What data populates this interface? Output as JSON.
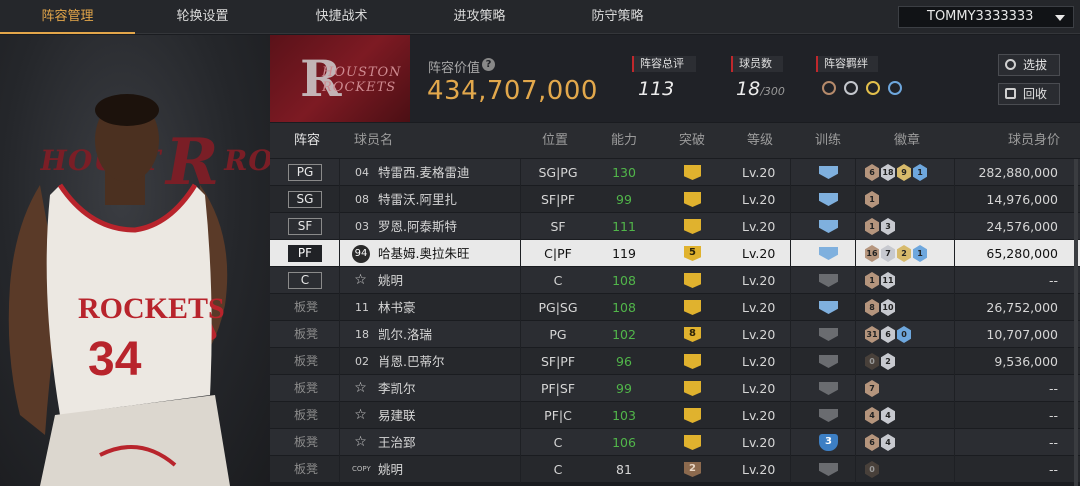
{
  "nav": {
    "tabs": [
      {
        "label": "阵容管理",
        "active": true
      },
      {
        "label": "轮换设置"
      },
      {
        "label": "快捷战术"
      },
      {
        "label": "进攻策略"
      },
      {
        "label": "防守策略"
      }
    ],
    "user": "TOMMY3333333"
  },
  "team": {
    "name": "HOUSTON ROCKETS",
    "value_label": "阵容价值",
    "value": "434,707,000",
    "overall_label": "阵容总评",
    "overall": "113",
    "count_label": "球员数",
    "count": "18",
    "count_max": "/300",
    "chem_label": "阵容羁绊",
    "chem_icons": [
      "bronze-team-icon",
      "silver-team-icon",
      "gold-team-icon",
      "blue-team-icon"
    ],
    "btn_select": "选拔",
    "btn_recycle": "回收"
  },
  "player_panel": {
    "background_logo": "HOUSTON ROCKETS",
    "jersey_team": "ROCKETS",
    "jersey_number": "34"
  },
  "table": {
    "headers": {
      "lineup": "阵容",
      "name": "球员名",
      "position": "位置",
      "ability": "能力",
      "breakthrough": "突破",
      "level": "等级",
      "training": "训练",
      "badges": "徽章",
      "value": "球员身价"
    },
    "rows": [
      {
        "slot": "PG",
        "num": "04",
        "numtype": "plain",
        "name": "特雷西.麦格雷迪",
        "pos": "SG|PG",
        "ability": "130",
        "green": true,
        "bt": "",
        "bt_type": "gold",
        "level": "Lv.20",
        "train": "blue",
        "badges": [
          [
            "bronze",
            "6"
          ],
          [
            "silver",
            "18"
          ],
          [
            "gold",
            "9"
          ],
          [
            "blue",
            "1"
          ]
        ],
        "value": "282,880,000"
      },
      {
        "slot": "SG",
        "num": "08",
        "numtype": "plain",
        "name": "特雷沃.阿里扎",
        "pos": "SF|PF",
        "ability": "99",
        "green": true,
        "bt": "",
        "bt_type": "gold",
        "level": "Lv.20",
        "train": "blue",
        "badges": [
          [
            "bronze",
            "1"
          ]
        ],
        "value": "14,976,000"
      },
      {
        "slot": "SF",
        "num": "03",
        "numtype": "plain",
        "name": "罗恩.阿泰斯特",
        "pos": "SF",
        "ability": "111",
        "green": true,
        "bt": "",
        "bt_type": "gold",
        "level": "Lv.20",
        "train": "blue",
        "badges": [
          [
            "bronze",
            "1"
          ],
          [
            "silver",
            "3"
          ]
        ],
        "value": "24,576,000"
      },
      {
        "slot": "PF",
        "num": "94",
        "numtype": "circle",
        "name": "哈基姆.奥拉朱旺",
        "pos": "C|PF",
        "ability": "119",
        "green": false,
        "bt": "5",
        "bt_type": "gold",
        "level": "Lv.20",
        "train": "blue",
        "badges": [
          [
            "bronze",
            "16"
          ],
          [
            "silver",
            "7"
          ],
          [
            "gold",
            "2"
          ],
          [
            "blue",
            "1"
          ]
        ],
        "value": "65,280,000",
        "selected": true
      },
      {
        "slot": "C",
        "num": "☆",
        "numtype": "star",
        "name": "姚明",
        "pos": "C",
        "ability": "108",
        "green": true,
        "bt": "",
        "bt_type": "gold",
        "level": "Lv.20",
        "train": "grey",
        "badges": [
          [
            "bronze",
            "1"
          ],
          [
            "silver",
            "11"
          ]
        ],
        "value": "--"
      },
      {
        "slot": "板凳",
        "num": "11",
        "numtype": "plain",
        "name": "林书豪",
        "pos": "PG|SG",
        "ability": "108",
        "green": true,
        "bt": "",
        "bt_type": "gold",
        "level": "Lv.20",
        "train": "blue",
        "badges": [
          [
            "bronze",
            "8"
          ],
          [
            "silver",
            "10"
          ]
        ],
        "value": "26,752,000"
      },
      {
        "slot": "板凳",
        "num": "18",
        "numtype": "plain",
        "name": "凯尔.洛瑞",
        "pos": "PG",
        "ability": "102",
        "green": true,
        "bt": "8",
        "bt_type": "gold",
        "level": "Lv.20",
        "train": "grey",
        "badges": [
          [
            "bronze",
            "31"
          ],
          [
            "silver",
            "6"
          ],
          [
            "blue",
            "0"
          ]
        ],
        "value": "10,707,000"
      },
      {
        "slot": "板凳",
        "num": "02",
        "numtype": "plain",
        "name": "肖恩.巴蒂尔",
        "pos": "SF|PF",
        "ability": "96",
        "green": true,
        "bt": "",
        "bt_type": "gold",
        "level": "Lv.20",
        "train": "grey",
        "badges": [
          [
            "dark",
            "0"
          ],
          [
            "silver",
            "2"
          ]
        ],
        "value": "9,536,000"
      },
      {
        "slot": "板凳",
        "num": "☆",
        "numtype": "star",
        "name": "李凯尔",
        "pos": "PF|SF",
        "ability": "99",
        "green": true,
        "bt": "",
        "bt_type": "gold",
        "level": "Lv.20",
        "train": "grey",
        "badges": [
          [
            "bronze",
            "7"
          ]
        ],
        "value": "--"
      },
      {
        "slot": "板凳",
        "num": "☆",
        "numtype": "star",
        "name": "易建联",
        "pos": "PF|C",
        "ability": "103",
        "green": true,
        "bt": "",
        "bt_type": "gold",
        "level": "Lv.20",
        "train": "grey",
        "badges": [
          [
            "bronze",
            "4"
          ],
          [
            "silver",
            "4"
          ]
        ],
        "value": "--"
      },
      {
        "slot": "板凳",
        "num": "☆",
        "numtype": "star",
        "name": "王治郅",
        "pos": "C",
        "ability": "106",
        "green": true,
        "bt": "",
        "bt_type": "gold",
        "level": "Lv.20",
        "train": "num3",
        "badges": [
          [
            "bronze",
            "6"
          ],
          [
            "silver",
            "4"
          ]
        ],
        "value": "--"
      },
      {
        "slot": "板凳",
        "num": "COPY",
        "numtype": "copy",
        "name": "姚明",
        "pos": "C",
        "ability": "81",
        "green": false,
        "bt": "2",
        "bt_type": "bronze",
        "level": "Lv.20",
        "train": "grey",
        "badges": [
          [
            "dark",
            "0"
          ]
        ],
        "value": "--"
      }
    ]
  }
}
